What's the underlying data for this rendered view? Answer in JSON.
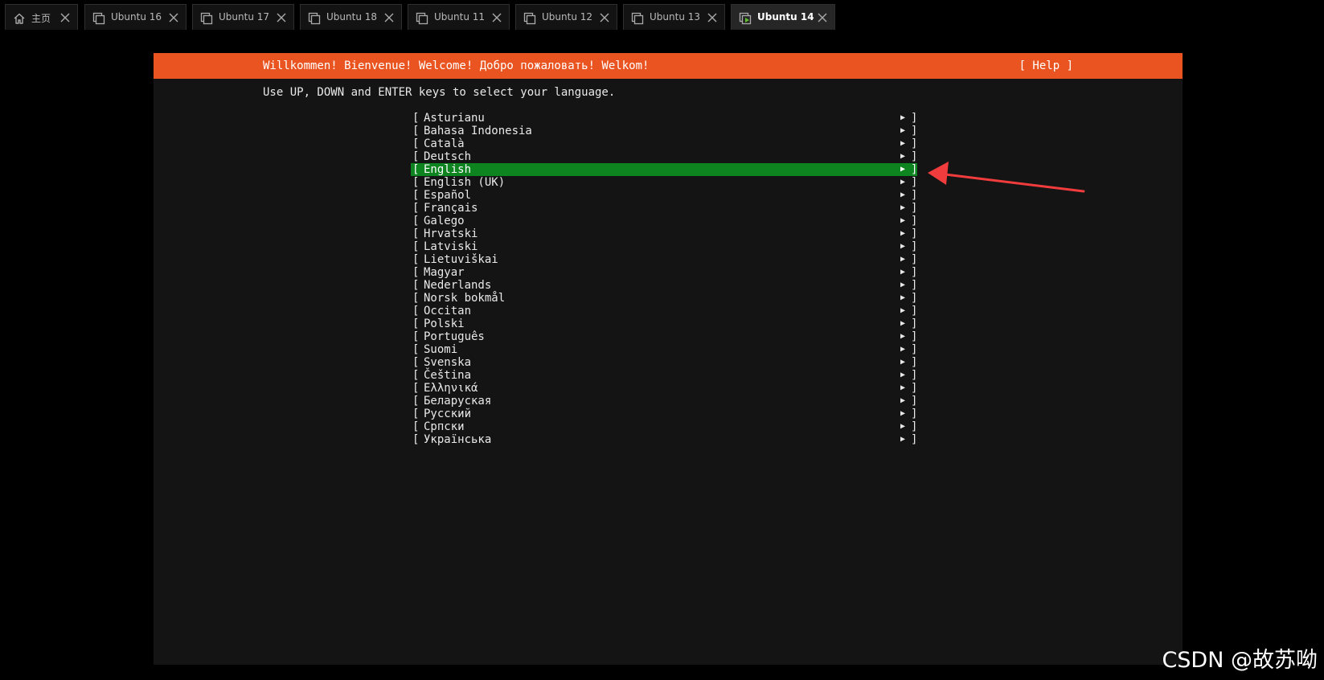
{
  "tabs": [
    {
      "label": "主页",
      "icon": "home-icon",
      "active": false
    },
    {
      "label": "Ubuntu 16",
      "icon": "vm-icon",
      "active": false
    },
    {
      "label": "Ubuntu 17",
      "icon": "vm-icon",
      "active": false
    },
    {
      "label": "Ubuntu 18",
      "icon": "vm-icon",
      "active": false
    },
    {
      "label": "Ubuntu 11",
      "icon": "vm-icon",
      "active": false
    },
    {
      "label": "Ubuntu 12",
      "icon": "vm-icon",
      "active": false
    },
    {
      "label": "Ubuntu 13",
      "icon": "vm-icon",
      "active": false
    },
    {
      "label": "Ubuntu 14",
      "icon": "vm-running-icon",
      "active": true
    }
  ],
  "installer": {
    "banner_title": "Willkommen! Bienvenue! Welcome! Добро пожаловать! Welkom!",
    "help_button": "[ Help ]",
    "instruction": "Use UP, DOWN and ENTER keys to select your language.",
    "item_open_bracket": "[",
    "item_close_bracket": "]",
    "item_arrow": "▶",
    "selected_language": "English",
    "languages": [
      "Asturianu",
      "Bahasa Indonesia",
      "Català",
      "Deutsch",
      "English",
      "English (UK)",
      "Español",
      "Français",
      "Galego",
      "Hrvatski",
      "Latviski",
      "Lietuviškai",
      "Magyar",
      "Nederlands",
      "Norsk bokmål",
      "Occitan",
      "Polski",
      "Português",
      "Suomi",
      "Svenska",
      "Čeština",
      "Ελληνικά",
      "Беларуская",
      "Русский",
      "Српски",
      "Українська"
    ]
  },
  "colors": {
    "banner": "#e95420",
    "selection": "#0e8420",
    "annotation_arrow": "#f03c3c",
    "console_background": "#141414"
  },
  "watermark": "CSDN @故苏呦"
}
